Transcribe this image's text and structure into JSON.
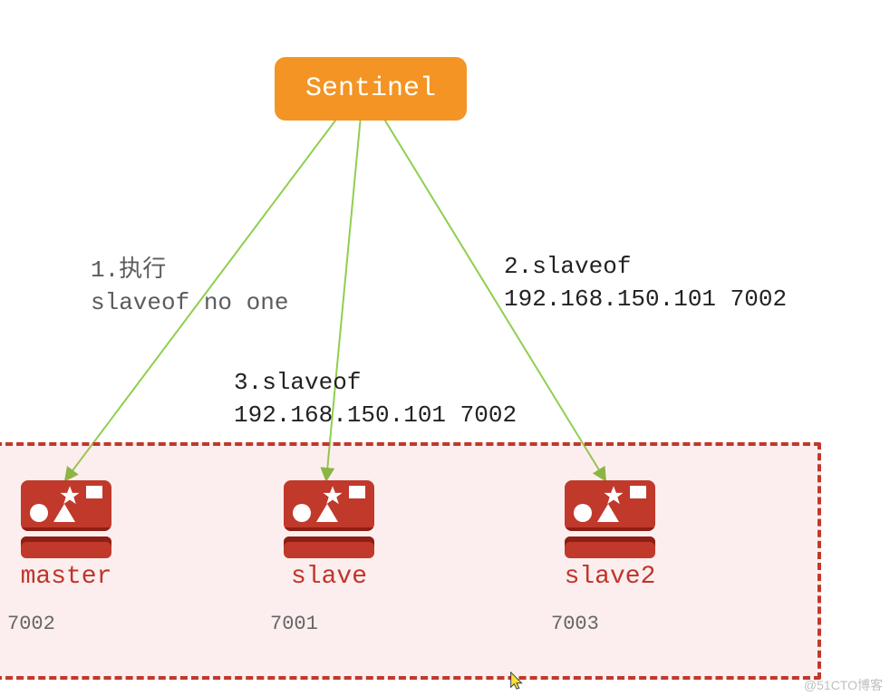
{
  "sentinel": {
    "label": "Sentinel"
  },
  "annotations": {
    "left_line1": "1.执行",
    "left_line2": "slaveof no one",
    "right_line1": "2.slaveof",
    "right_line2": "192.168.150.101 7002",
    "mid_line1": "3.slaveof",
    "mid_line2": "192.168.150.101 7002"
  },
  "nodes": {
    "n1": {
      "label": "master",
      "port": "7002"
    },
    "n2": {
      "label": "slave",
      "port": "7001"
    },
    "n3": {
      "label": "slave2",
      "port": "7003"
    }
  },
  "watermark": "@51CTO博客",
  "icons": {
    "redis": "redis-icon"
  }
}
